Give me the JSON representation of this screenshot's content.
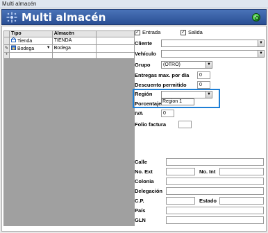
{
  "window": {
    "title": "Multi almacén"
  },
  "header": {
    "title": "Multi almacén"
  },
  "grid": {
    "columns": [
      "Tipo",
      "Almacén"
    ],
    "rows": [
      {
        "tipo": "Tienda",
        "almacen": "TIENDA"
      },
      {
        "tipo": "Bodega",
        "almacen": "Bodega"
      }
    ],
    "row_markers": [
      "",
      "",
      "✎",
      "*"
    ]
  },
  "form": {
    "entrada": {
      "label": "Entrada",
      "checked": true
    },
    "salida": {
      "label": "Salida",
      "checked": true
    },
    "cliente": {
      "label": "Cliente",
      "value": ""
    },
    "vehiculo": {
      "label": "Vehículo",
      "value": ""
    },
    "grupo": {
      "label": "Grupo",
      "value": "(OTRO)"
    },
    "entregas": {
      "label": "Entregas max. por día",
      "value": "0"
    },
    "descuento": {
      "label": "Descuento permitido",
      "value": "0"
    },
    "region": {
      "label": "Región",
      "value": "",
      "options": [
        "Region 1"
      ]
    },
    "porcentaje": {
      "label": "Porcentaje sobre costo"
    },
    "iva": {
      "label": "IVA",
      "value": "0"
    },
    "folio": {
      "label": "Folio factura",
      "value": ""
    },
    "calle": {
      "label": "Calle",
      "value": ""
    },
    "no_ext": {
      "label": "No. Ext",
      "value": ""
    },
    "no_int": {
      "label": "No. Int",
      "value": ""
    },
    "colonia": {
      "label": "Colonia",
      "value": ""
    },
    "delegacion": {
      "label": "Delegación",
      "value": ""
    },
    "cp": {
      "label": "C.P.",
      "value": ""
    },
    "estado": {
      "label": "Estado",
      "value": ""
    },
    "pais": {
      "label": "País",
      "value": ""
    },
    "gln": {
      "label": "GLN",
      "value": ""
    }
  },
  "colors": {
    "accent": "#1e7fd6",
    "header": "#2a4f94"
  }
}
